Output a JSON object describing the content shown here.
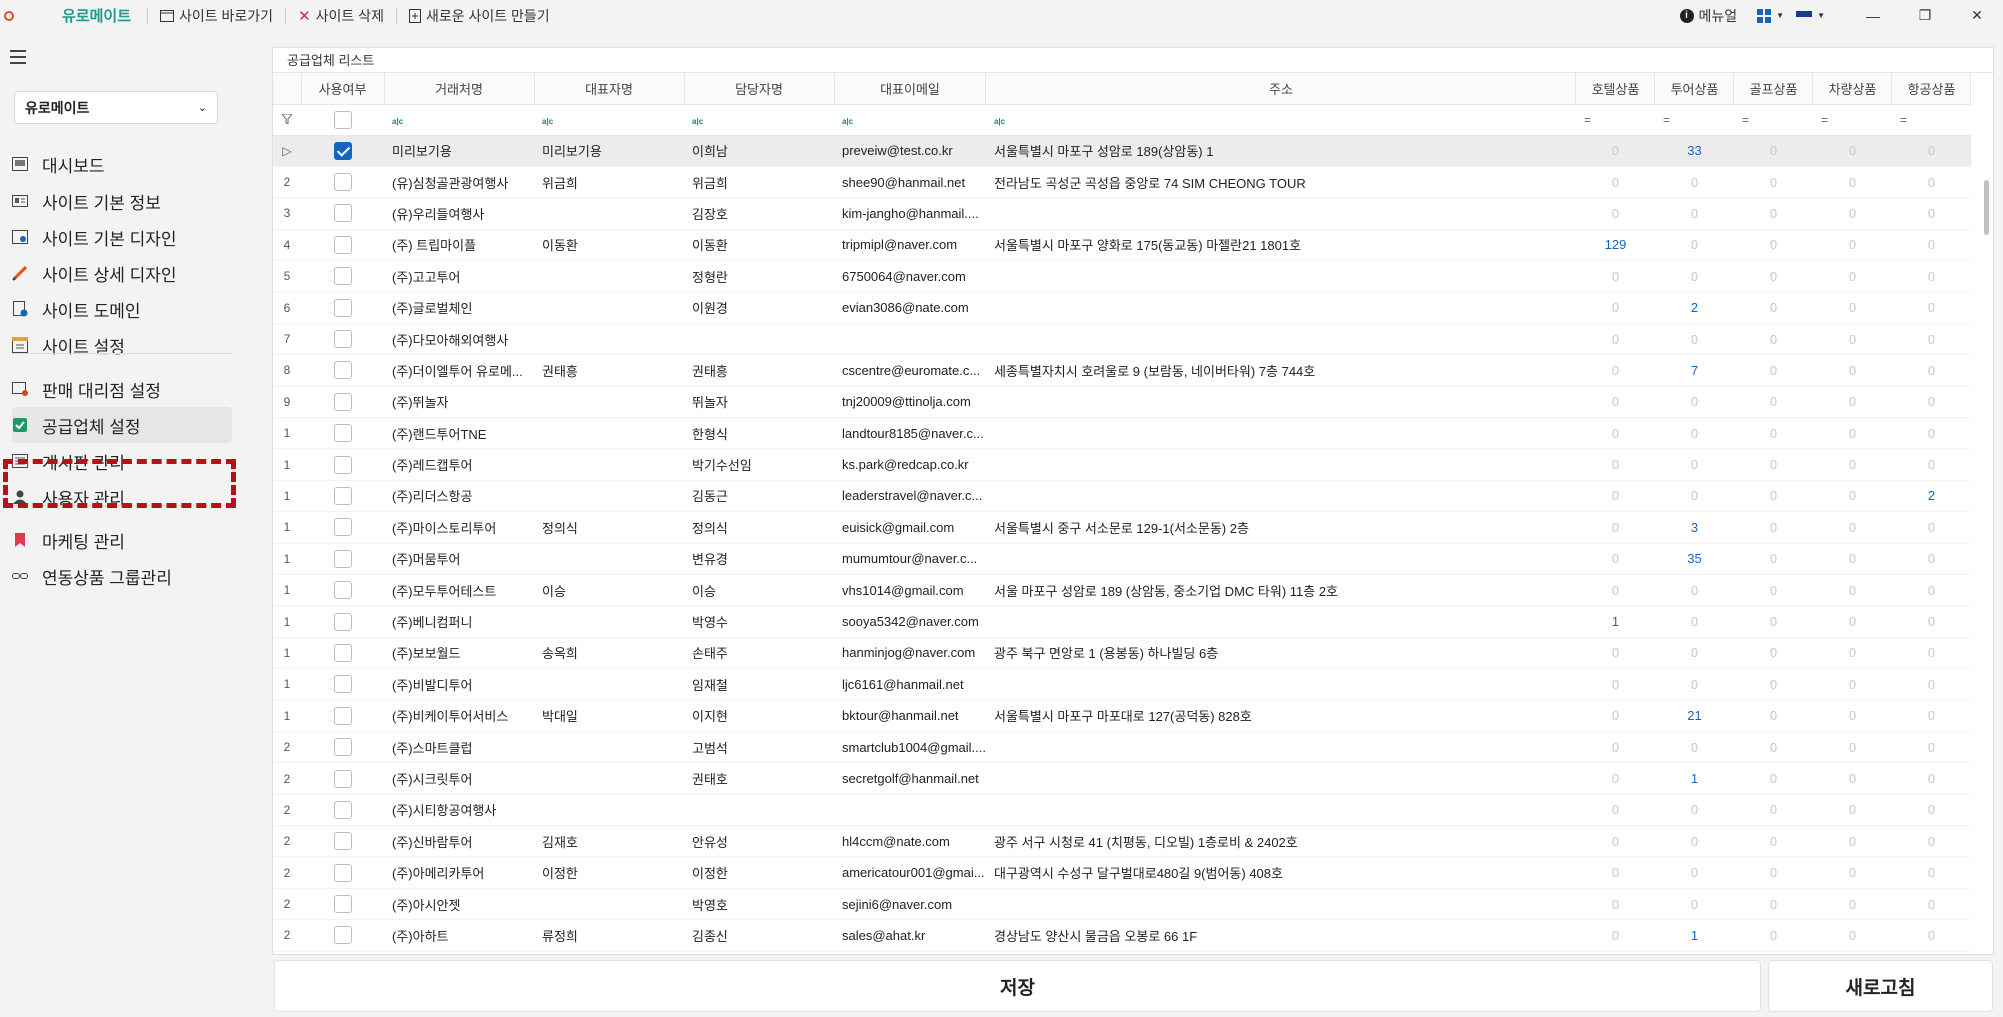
{
  "titlebar": {
    "app_name": "유로메이트",
    "buttons": [
      "사이트 바로가기",
      "사이트 삭제",
      "새로운 사이트 만들기"
    ],
    "manual": "메뉴얼",
    "window_controls": [
      "—",
      "❐",
      "✕"
    ]
  },
  "sidebar": {
    "site_select": "유로메이트",
    "items": [
      {
        "label": "대시보드",
        "icon": "dashboard-icon"
      },
      {
        "label": "사이트 기본 정보",
        "icon": "id-card-icon"
      },
      {
        "label": "사이트 기본 디자인",
        "icon": "design-icon"
      },
      {
        "label": "사이트 상세 디자인",
        "icon": "pencil-icon"
      },
      {
        "label": "사이트 도메인",
        "icon": "domain-icon"
      },
      {
        "label": "사이트 설정",
        "icon": "settings-icon"
      },
      {
        "label": "판매 대리점 설정",
        "icon": "agency-icon"
      },
      {
        "label": "공급업체 설정",
        "icon": "checkbox-icon"
      },
      {
        "label": "게시판 관리",
        "icon": "board-icon"
      },
      {
        "label": "사용자 관리",
        "icon": "user-icon"
      },
      {
        "label": "마케팅 관리",
        "icon": "bookmark-icon"
      },
      {
        "label": "연동상품 그룹관리",
        "icon": "link-icon"
      }
    ]
  },
  "panel": {
    "title": "공급업체 리스트",
    "columns": [
      "사용여부",
      "거래처명",
      "대표자명",
      "담당자명",
      "대표이메일",
      "주소",
      "호텔상품",
      "투어상품",
      "골프상품",
      "차량상품",
      "항공상품"
    ],
    "rows": [
      {
        "idx": "▷",
        "on": true,
        "name": "미리보기용",
        "rep": "미리보기용",
        "mgr": "이희남",
        "email": "preveiw@test.co.kr",
        "addr": "서울특별시 마포구 성암로 189(상암동) 1",
        "n": [
          "0",
          "33",
          "0",
          "0",
          "0"
        ]
      },
      {
        "idx": "2",
        "on": false,
        "name": "(유)심청골관광여행사",
        "rep": "위금희",
        "mgr": "위금희",
        "email": "shee90@hanmail.net",
        "addr": "전라남도 곡성군 곡성읍 중앙로 74 SIM CHEONG TOUR",
        "n": [
          "0",
          "0",
          "0",
          "0",
          "0"
        ]
      },
      {
        "idx": "3",
        "on": false,
        "name": "(유)우리들여행사",
        "rep": "",
        "mgr": "김장호",
        "email": "kim-jangho@hanmail....",
        "addr": "",
        "n": [
          "0",
          "0",
          "0",
          "0",
          "0"
        ]
      },
      {
        "idx": "4",
        "on": false,
        "name": "(주) 트립마이플",
        "rep": "이동환",
        "mgr": "이동환",
        "email": "tripmipl@naver.com",
        "addr": "서울특별시 마포구 양화로 175(동교동) 마젤란21 1801호",
        "n": [
          "129",
          "0",
          "0",
          "0",
          "0"
        ]
      },
      {
        "idx": "5",
        "on": false,
        "name": "(주)고고투어",
        "rep": "",
        "mgr": "정형란",
        "email": "6750064@naver.com",
        "addr": "",
        "n": [
          "0",
          "0",
          "0",
          "0",
          "0"
        ]
      },
      {
        "idx": "6",
        "on": false,
        "name": "(주)글로벌체인",
        "rep": "",
        "mgr": "이원경",
        "email": "evian3086@nate.com",
        "addr": "",
        "n": [
          "0",
          "2",
          "0",
          "0",
          "0"
        ]
      },
      {
        "idx": "7",
        "on": false,
        "name": "(주)다모아해외여행사",
        "rep": "",
        "mgr": "",
        "email": "",
        "addr": "",
        "n": [
          "0",
          "0",
          "0",
          "0",
          "0"
        ]
      },
      {
        "idx": "8",
        "on": false,
        "name": "(주)더이엘투어 유로메...",
        "rep": "권태흥",
        "mgr": "권태흥",
        "email": "cscentre@euromate.c...",
        "addr": "세종특별자치시 호려울로 9 (보람동, 네이버타워) 7층 744호",
        "n": [
          "0",
          "7",
          "0",
          "0",
          "0"
        ]
      },
      {
        "idx": "9",
        "on": false,
        "name": "(주)뛰놀자",
        "rep": "",
        "mgr": "뛰놀자",
        "email": "tnj20009@ttinolja.com",
        "addr": "",
        "n": [
          "0",
          "0",
          "0",
          "0",
          "0"
        ]
      },
      {
        "idx": "1",
        "on": false,
        "name": "(주)랜드투어TNE",
        "rep": "",
        "mgr": "한형식",
        "email": "landtour8185@naver.c...",
        "addr": "",
        "n": [
          "0",
          "0",
          "0",
          "0",
          "0"
        ]
      },
      {
        "idx": "1",
        "on": false,
        "name": "(주)레드캡투어",
        "rep": "",
        "mgr": "박기수선임",
        "email": "ks.park@redcap.co.kr",
        "addr": "",
        "n": [
          "0",
          "0",
          "0",
          "0",
          "0"
        ]
      },
      {
        "idx": "1",
        "on": false,
        "name": "(주)리더스항공",
        "rep": "",
        "mgr": "김동근",
        "email": "leaderstravel@naver.c...",
        "addr": "",
        "n": [
          "0",
          "0",
          "0",
          "0",
          "2"
        ]
      },
      {
        "idx": "1",
        "on": false,
        "name": "(주)마이스토리투어",
        "rep": "정의식",
        "mgr": "정의식",
        "email": "euisick@gmail.com",
        "addr": "서울특별시 중구 서소문로 129-1(서소문동) 2층",
        "n": [
          "0",
          "3",
          "0",
          "0",
          "0"
        ]
      },
      {
        "idx": "1",
        "on": false,
        "name": "(주)머뭄투어",
        "rep": "",
        "mgr": "변유경",
        "email": "mumumtour@naver.c...",
        "addr": "",
        "n": [
          "0",
          "35",
          "0",
          "0",
          "0"
        ]
      },
      {
        "idx": "1",
        "on": false,
        "name": "(주)모두투어테스트",
        "rep": "이승",
        "mgr": "이승",
        "email": "vhs1014@gmail.com",
        "addr": "서울 마포구 성암로 189 (상암동, 중소기업 DMC 타워) 11층 2호",
        "n": [
          "0",
          "0",
          "0",
          "0",
          "0"
        ]
      },
      {
        "idx": "1",
        "on": false,
        "name": "(주)베니컴퍼니",
        "rep": "",
        "mgr": "박영수",
        "email": "sooya5342@naver.com",
        "addr": "",
        "n": [
          "1",
          "0",
          "0",
          "0",
          "0"
        ]
      },
      {
        "idx": "1",
        "on": false,
        "name": "(주)보보월드",
        "rep": "송옥희",
        "mgr": "손태주",
        "email": "hanminjog@naver.com",
        "addr": "광주 북구 면앙로 1 (용봉동) 하나빌딩 6층",
        "n": [
          "0",
          "0",
          "0",
          "0",
          "0"
        ]
      },
      {
        "idx": "1",
        "on": false,
        "name": "(주)비발디투어",
        "rep": "",
        "mgr": "임재철",
        "email": "ljc6161@hanmail.net",
        "addr": "",
        "n": [
          "0",
          "0",
          "0",
          "0",
          "0"
        ]
      },
      {
        "idx": "1",
        "on": false,
        "name": "(주)비케이투어서비스",
        "rep": "박대일",
        "mgr": "이지현",
        "email": "bktour@hanmail.net",
        "addr": "서울특별시 마포구 마포대로 127(공덕동) 828호",
        "n": [
          "0",
          "21",
          "0",
          "0",
          "0"
        ]
      },
      {
        "idx": "2",
        "on": false,
        "name": "(주)스마트클럽",
        "rep": "",
        "mgr": "고범석",
        "email": "smartclub1004@gmail....",
        "addr": "",
        "n": [
          "0",
          "0",
          "0",
          "0",
          "0"
        ]
      },
      {
        "idx": "2",
        "on": false,
        "name": "(주)시크릿투어",
        "rep": "",
        "mgr": "권태호",
        "email": "secretgolf@hanmail.net",
        "addr": "",
        "n": [
          "0",
          "1",
          "0",
          "0",
          "0"
        ]
      },
      {
        "idx": "2",
        "on": false,
        "name": "(주)시티항공여행사",
        "rep": "",
        "mgr": "",
        "email": "",
        "addr": "",
        "n": [
          "0",
          "0",
          "0",
          "0",
          "0"
        ]
      },
      {
        "idx": "2",
        "on": false,
        "name": "(주)신바람투어",
        "rep": "김재호",
        "mgr": "안유성",
        "email": "hl4ccm@nate.com",
        "addr": "광주 서구 시청로 41 (치평동, 디오빌) 1층로비 & 2402호",
        "n": [
          "0",
          "0",
          "0",
          "0",
          "0"
        ]
      },
      {
        "idx": "2",
        "on": false,
        "name": "(주)아메리카투어",
        "rep": "이정한",
        "mgr": "이정한",
        "email": "americatour001@gmai...",
        "addr": "대구광역시 수성구 달구벌대로480길 9(범어동) 408호",
        "n": [
          "0",
          "0",
          "0",
          "0",
          "0"
        ]
      },
      {
        "idx": "2",
        "on": false,
        "name": "(주)아시안젯",
        "rep": "",
        "mgr": "박영호",
        "email": "sejini6@naver.com",
        "addr": "",
        "n": [
          "0",
          "0",
          "0",
          "0",
          "0"
        ]
      },
      {
        "idx": "2",
        "on": false,
        "name": "(주)아하트",
        "rep": "류정희",
        "mgr": "김종신",
        "email": "sales@ahat.kr",
        "addr": "경상남도 양산시 물금읍 오봉로 66 1F",
        "n": [
          "0",
          "1",
          "0",
          "0",
          "0"
        ]
      }
    ]
  },
  "footer": {
    "save_label": "저장",
    "refresh_label": "새로고침"
  },
  "colors": {
    "accent": "#1565c0",
    "brand": "#1c9a8a",
    "highlight_box": "#b5121b"
  }
}
